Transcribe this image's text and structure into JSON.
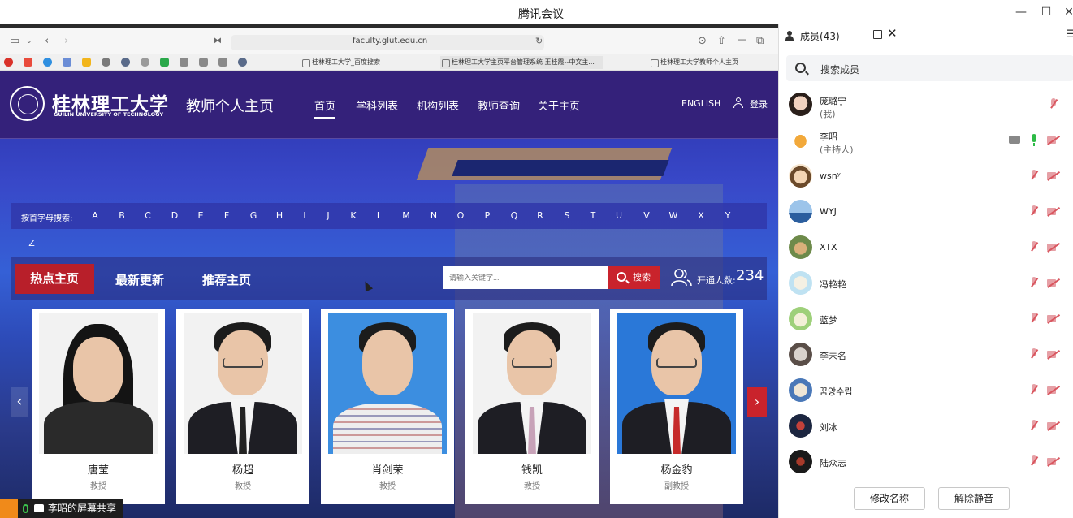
{
  "window": {
    "title": "腾讯会议"
  },
  "browser": {
    "url": "faculty.glut.edu.cn",
    "tabs": [
      "桂林理工大学_百度搜索",
      "桂林理工大学主页平台管理系统 王桂霞--中文主...",
      "桂林理工大学教师个人主页"
    ]
  },
  "site": {
    "logo_cn": "桂林理工大学",
    "logo_en": "GUILIN UNIVERSITY OF TECHNOLOGY",
    "subtitle": "教师个人主页",
    "nav": [
      "首页",
      "学科列表",
      "机构列表",
      "教师查询",
      "关于主页"
    ],
    "english": "ENGLISH",
    "login": "登录",
    "alpha_label": "按首字母搜索:",
    "letters": [
      "A",
      "B",
      "C",
      "D",
      "E",
      "F",
      "G",
      "H",
      "I",
      "J",
      "K",
      "L",
      "M",
      "N",
      "O",
      "P",
      "Q",
      "R",
      "S",
      "T",
      "U",
      "V",
      "W",
      "X",
      "Y",
      "Z"
    ],
    "tabs": [
      "热点主页",
      "最新更新",
      "推荐主页"
    ],
    "search_placeholder": "请输入关键字...",
    "search_button": "搜索",
    "count_label": "开通人数:",
    "count_value": "234",
    "teachers": [
      {
        "name": "唐莹",
        "title": "教授"
      },
      {
        "name": "杨超",
        "title": "教授"
      },
      {
        "name": "肖剑荣",
        "title": "教授"
      },
      {
        "name": "钱凯",
        "title": "教授"
      },
      {
        "name": "杨金豹",
        "title": "副教授"
      }
    ]
  },
  "share_badge": "李昭的屏幕共享",
  "panel": {
    "title": "成员(43)",
    "search_placeholder": "搜索成员",
    "members": [
      {
        "name": "庞璐宁",
        "role": "(我)"
      },
      {
        "name": "李昭",
        "role": "(主持人)"
      },
      {
        "name": "wsnʸ",
        "role": ""
      },
      {
        "name": "WYJ",
        "role": ""
      },
      {
        "name": "XTX",
        "role": ""
      },
      {
        "name": "冯艳艳",
        "role": ""
      },
      {
        "name": "蓝梦",
        "role": ""
      },
      {
        "name": "李未名",
        "role": ""
      },
      {
        "name": "꿈앙수립",
        "role": ""
      },
      {
        "name": "刘冰",
        "role": ""
      },
      {
        "name": "陆众志",
        "role": ""
      }
    ],
    "footer": {
      "rename": "修改名称",
      "unmute": "解除静音"
    }
  }
}
